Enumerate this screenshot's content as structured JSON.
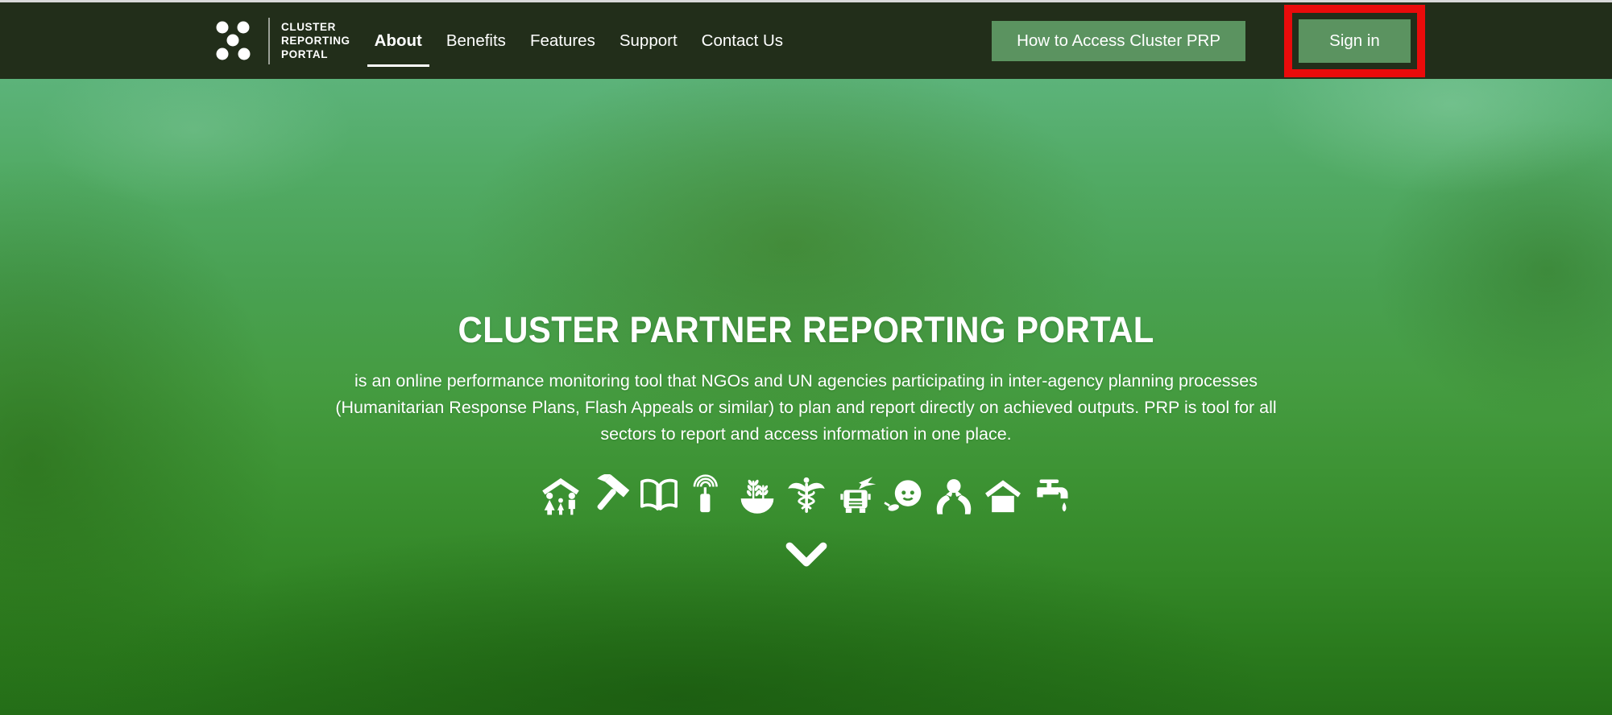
{
  "navbar": {
    "logo": {
      "lines": [
        "CLUSTER",
        "REPORTING",
        "PORTAL"
      ]
    },
    "links": [
      {
        "label": "About",
        "active": true
      },
      {
        "label": "Benefits",
        "active": false
      },
      {
        "label": "Features",
        "active": false
      },
      {
        "label": "Support",
        "active": false
      },
      {
        "label": "Contact Us",
        "active": false
      }
    ],
    "access_button_label": "How to Access Cluster PRP",
    "signin_button_label": "Sign in"
  },
  "annotation": {
    "shape": "red-rectangle-highlight",
    "target": "signin-button",
    "color": "#ea0b0b"
  },
  "hero": {
    "title": "CLUSTER PARTNER REPORTING PORTAL",
    "description": "is an online performance monitoring tool that NGOs and UN agencies participating in inter-agency planning processes (Humanitarian Response Plans, Flash Appeals or similar) to plan and report directly on achieved outputs. PRP is tool for all sectors to report and access information in one place.",
    "cluster_icons": [
      "camp-coordination-icon",
      "early-recovery-icon",
      "education-icon",
      "telecommunications-icon",
      "food-security-icon",
      "health-icon",
      "logistics-icon",
      "nutrition-icon",
      "protection-icon",
      "shelter-icon",
      "wash-icon"
    ],
    "scroll_indicator": "chevron-down-icon"
  },
  "colors": {
    "navbar_bg": "#222e1a",
    "button_green": "#5b9360",
    "annotation_red": "#ea0b0b",
    "hero_overlay_green": "#459c41",
    "text": "#ffffff"
  }
}
